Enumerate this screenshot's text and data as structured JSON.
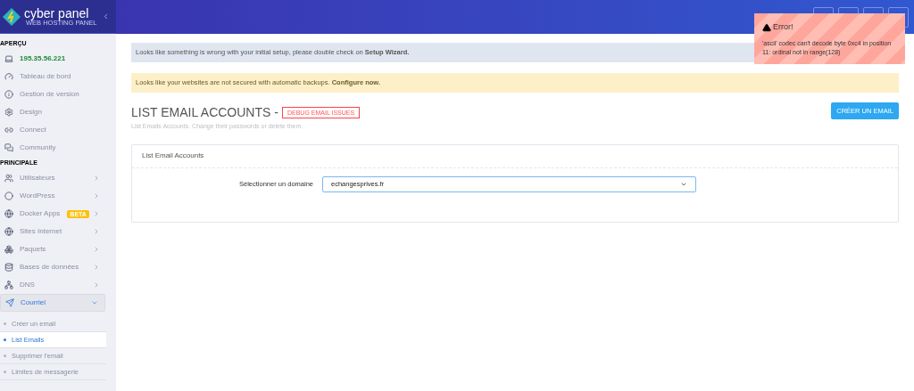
{
  "brand": {
    "name": "cyber panel",
    "tagline": "WEB HOSTING PANEL"
  },
  "sidebar": {
    "sections": [
      {
        "title": "APERÇU",
        "items": [
          {
            "label": "195.35.56.221",
            "kind": "ip"
          },
          {
            "label": "Tableau de bord",
            "kind": "link"
          },
          {
            "label": "Gestion de version",
            "kind": "link"
          },
          {
            "label": "Design",
            "kind": "link"
          },
          {
            "label": "Connect",
            "kind": "link"
          },
          {
            "label": "Community",
            "kind": "link"
          }
        ]
      },
      {
        "title": "PRINCIPALE",
        "items": [
          {
            "label": "Utilisateurs",
            "kind": "menu",
            "expanded": false
          },
          {
            "label": "WordPress",
            "kind": "menu",
            "expanded": false
          },
          {
            "label": "Docker Apps",
            "kind": "menu",
            "expanded": false,
            "badge": "BETA"
          },
          {
            "label": "Sites Internet",
            "kind": "menu",
            "expanded": false
          },
          {
            "label": "Paquets",
            "kind": "menu",
            "expanded": false
          },
          {
            "label": "Bases de données",
            "kind": "menu",
            "expanded": false
          },
          {
            "label": "DNS",
            "kind": "menu",
            "expanded": false
          },
          {
            "label": "Courriel",
            "kind": "menu",
            "expanded": true,
            "children": [
              {
                "label": "Créer un email",
                "selected": false
              },
              {
                "label": "List Emails",
                "selected": true
              },
              {
                "label": "Supprimer l'email",
                "selected": false
              },
              {
                "label": "Limites de messagerie",
                "selected": false
              }
            ]
          }
        ]
      }
    ]
  },
  "alerts": [
    {
      "kind": "info",
      "text": "Looks like something is wrong with your initial setup, please double check on **Setup Wizard.**"
    },
    {
      "kind": "warning",
      "text": "Looks like your websites are not secured with automatic backups. **Configure now.**"
    }
  ],
  "page": {
    "title": "LIST EMAIL ACCOUNTS -",
    "debug_button": "DEBUG EMAIL ISSUES",
    "subtitle": "List Emails Accounts. Change their passwords or delete them.",
    "create_button": "CRÉER UN EMAIL"
  },
  "panel": {
    "title": "List Email Accounts",
    "field_label": "Sélectionner un domaine",
    "domain": "echangesprives.fr"
  },
  "toast": {
    "title": "Error!",
    "message": "'ascii' codec can't decode byte 0xc4 in position 11: ordinal not in range(128)"
  }
}
